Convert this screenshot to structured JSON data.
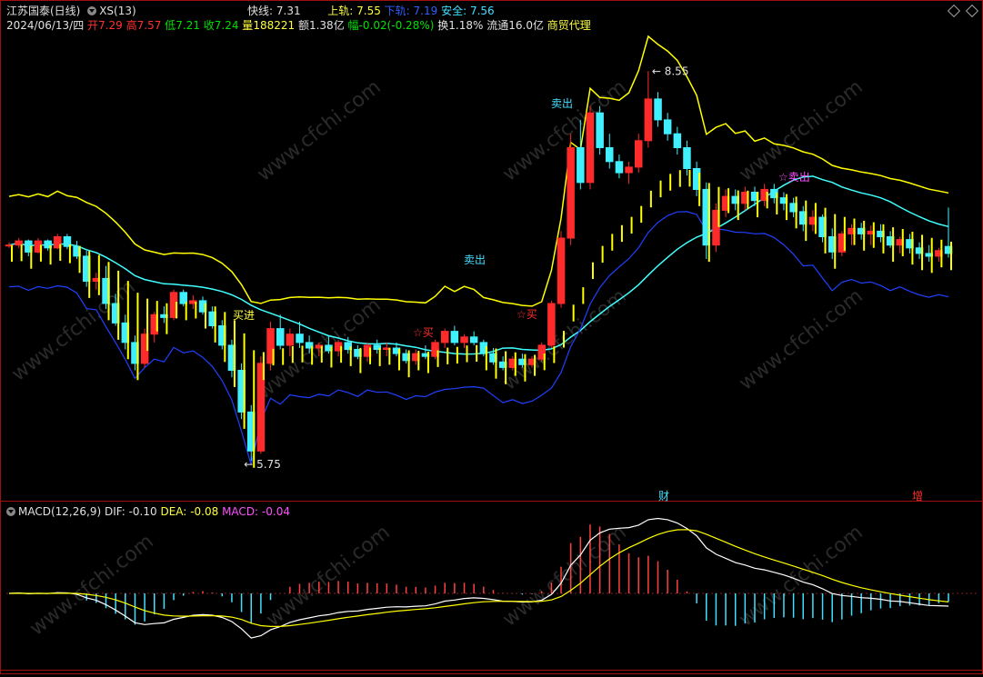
{
  "header": {
    "stock_name": "江苏国泰(日线)",
    "indicator_name": "XS(13)",
    "fast_label": "快线:",
    "fast_value": "7.31",
    "upper_label": "上轨:",
    "upper_value": "7.55",
    "lower_label": "下轨:",
    "lower_value": "7.19",
    "safe_label": "安全:",
    "safe_value": "7.56"
  },
  "quote": {
    "date": "2024/06/13/四",
    "open_label": "开",
    "open": "7.29",
    "high_label": "高",
    "high": "7.57",
    "low_label": "低",
    "low": "7.21",
    "close_label": "收",
    "close": "7.24",
    "volume_label": "量",
    "volume": "188221",
    "amount_label": "额",
    "amount": "1.38亿",
    "change_label": "幅",
    "change": "-0.02(-0.28%)",
    "turnover_label": "换",
    "turnover": "1.18%",
    "float_label": "流通",
    "float": "16.0亿",
    "sector": "商贸代理"
  },
  "macd_header": {
    "name": "MACD(12,26,9)",
    "dif_label": "DIF:",
    "dif": "-0.10",
    "dea_label": "DEA:",
    "dea": "-0.08",
    "macd_label": "MACD:",
    "macd": "-0.04"
  },
  "markers": {
    "low_price": "5.75",
    "high_price": "8.55",
    "sell_1": "卖出",
    "sell_2": "卖出",
    "sell_3": "☆卖出",
    "buy_in": "买进",
    "buy_1": "☆买",
    "buy_2": "☆买",
    "cai": "财",
    "zeng": "增"
  },
  "watermark": "www.cfchi.com",
  "colors": {
    "up": "#ff2a2a",
    "down": "#40f0ff",
    "bg": "#000000",
    "border": "#a01010",
    "fast_line": "#ffff00",
    "mid_line": "#40ffff",
    "lower_line": "#2040ff",
    "dif": "#ffffff",
    "dea": "#ffff00"
  },
  "chart_data": [
    {
      "type": "candlestick",
      "title": "江苏国泰(日线)",
      "y_unit": "CNY",
      "ylim": [
        5.6,
        8.8
      ],
      "annotations": [
        {
          "label": "5.75",
          "kind": "low"
        },
        {
          "label": "8.55",
          "kind": "high"
        }
      ],
      "last_candle": {
        "open": 7.29,
        "high": 7.57,
        "low": 7.21,
        "close": 7.24
      },
      "lines": [
        {
          "name": "快线",
          "last": 7.31
        },
        {
          "name": "上轨",
          "last": 7.55
        },
        {
          "name": "下轨",
          "last": 7.19
        },
        {
          "name": "安全",
          "last": 7.56
        }
      ],
      "candles_approx": [
        [
          7.3,
          7.32,
          7.28,
          7.3
        ],
        [
          7.3,
          7.35,
          7.28,
          7.33
        ],
        [
          7.33,
          7.34,
          7.22,
          7.25
        ],
        [
          7.25,
          7.35,
          7.24,
          7.33
        ],
        [
          7.33,
          7.34,
          7.26,
          7.28
        ],
        [
          7.28,
          7.38,
          7.27,
          7.36
        ],
        [
          7.36,
          7.38,
          7.27,
          7.29
        ],
        [
          7.29,
          7.33,
          7.2,
          7.22
        ],
        [
          7.22,
          7.26,
          7.0,
          7.04
        ],
        [
          7.04,
          7.1,
          6.98,
          7.06
        ],
        [
          7.06,
          7.15,
          6.84,
          6.88
        ],
        [
          6.88,
          6.95,
          6.72,
          6.74
        ],
        [
          6.74,
          6.8,
          6.55,
          6.6
        ],
        [
          6.6,
          6.65,
          6.4,
          6.45
        ],
        [
          6.45,
          6.7,
          6.42,
          6.66
        ],
        [
          6.66,
          6.82,
          6.6,
          6.8
        ],
        [
          6.8,
          6.86,
          6.74,
          6.78
        ],
        [
          6.78,
          6.98,
          6.76,
          6.96
        ],
        [
          6.96,
          6.98,
          6.86,
          6.88
        ],
        [
          6.88,
          6.94,
          6.84,
          6.9
        ],
        [
          6.9,
          6.93,
          6.8,
          6.82
        ],
        [
          6.82,
          6.86,
          6.7,
          6.72
        ],
        [
          6.72,
          6.76,
          6.55,
          6.58
        ],
        [
          6.58,
          6.62,
          6.35,
          6.4
        ],
        [
          6.4,
          6.45,
          6.05,
          6.1
        ],
        [
          6.1,
          6.15,
          5.75,
          5.82
        ],
        [
          5.82,
          6.5,
          5.8,
          6.45
        ],
        [
          6.45,
          6.75,
          6.4,
          6.7
        ],
        [
          6.7,
          6.8,
          6.55,
          6.58
        ],
        [
          6.58,
          6.7,
          6.5,
          6.66
        ],
        [
          6.66,
          6.75,
          6.56,
          6.6
        ],
        [
          6.6,
          6.65,
          6.52,
          6.56
        ],
        [
          6.56,
          6.6,
          6.5,
          6.58
        ],
        [
          6.58,
          6.65,
          6.52,
          6.54
        ],
        [
          6.54,
          6.62,
          6.5,
          6.6
        ],
        [
          6.6,
          6.64,
          6.52,
          6.55
        ],
        [
          6.55,
          6.58,
          6.48,
          6.5
        ],
        [
          6.5,
          6.6,
          6.46,
          6.58
        ],
        [
          6.58,
          6.62,
          6.52,
          6.55
        ],
        [
          6.55,
          6.6,
          6.5,
          6.56
        ],
        [
          6.56,
          6.6,
          6.5,
          6.52
        ],
        [
          6.52,
          6.55,
          6.45,
          6.47
        ],
        [
          6.47,
          6.55,
          6.44,
          6.52
        ],
        [
          6.52,
          6.58,
          6.48,
          6.5
        ],
        [
          6.5,
          6.62,
          6.48,
          6.6
        ],
        [
          6.6,
          6.7,
          6.56,
          6.68
        ],
        [
          6.68,
          6.72,
          6.58,
          6.6
        ],
        [
          6.6,
          6.66,
          6.56,
          6.64
        ],
        [
          6.64,
          6.68,
          6.58,
          6.6
        ],
        [
          6.6,
          6.62,
          6.5,
          6.52
        ],
        [
          6.52,
          6.56,
          6.44,
          6.46
        ],
        [
          6.46,
          6.5,
          6.4,
          6.42
        ],
        [
          6.42,
          6.5,
          6.4,
          6.48
        ],
        [
          6.48,
          6.52,
          6.42,
          6.44
        ],
        [
          6.44,
          6.5,
          6.42,
          6.48
        ],
        [
          6.48,
          6.6,
          6.46,
          6.58
        ],
        [
          6.58,
          6.9,
          6.56,
          6.88
        ],
        [
          6.88,
          7.4,
          6.85,
          7.35
        ],
        [
          7.35,
          8.1,
          7.3,
          8.0
        ],
        [
          8.0,
          8.2,
          7.7,
          7.75
        ],
        [
          7.75,
          8.3,
          7.7,
          8.25
        ],
        [
          8.25,
          8.3,
          7.95,
          8.0
        ],
        [
          8.0,
          8.1,
          7.85,
          7.9
        ],
        [
          7.9,
          7.95,
          7.78,
          7.82
        ],
        [
          7.82,
          7.9,
          7.74,
          7.86
        ],
        [
          7.86,
          8.1,
          7.82,
          8.05
        ],
        [
          8.05,
          8.55,
          8.0,
          8.35
        ],
        [
          8.35,
          8.4,
          8.15,
          8.2
        ],
        [
          8.2,
          8.25,
          8.05,
          8.1
        ],
        [
          8.1,
          8.15,
          7.95,
          8.0
        ],
        [
          8.0,
          8.05,
          7.8,
          7.85
        ],
        [
          7.85,
          7.9,
          7.65,
          7.7
        ],
        [
          7.7,
          7.75,
          7.2,
          7.3
        ],
        [
          7.3,
          7.6,
          7.25,
          7.55
        ],
        [
          7.55,
          7.7,
          7.5,
          7.65
        ],
        [
          7.65,
          7.7,
          7.55,
          7.6
        ],
        [
          7.6,
          7.72,
          7.55,
          7.68
        ],
        [
          7.68,
          7.72,
          7.58,
          7.62
        ],
        [
          7.62,
          7.74,
          7.58,
          7.7
        ],
        [
          7.7,
          7.74,
          7.6,
          7.64
        ],
        [
          7.64,
          7.68,
          7.55,
          7.6
        ],
        [
          7.6,
          7.64,
          7.5,
          7.54
        ],
        [
          7.54,
          7.58,
          7.4,
          7.45
        ],
        [
          7.45,
          7.55,
          7.4,
          7.5
        ],
        [
          7.5,
          7.52,
          7.32,
          7.36
        ],
        [
          7.36,
          7.42,
          7.2,
          7.25
        ],
        [
          7.25,
          7.4,
          7.22,
          7.38
        ],
        [
          7.38,
          7.45,
          7.3,
          7.42
        ],
        [
          7.42,
          7.46,
          7.34,
          7.38
        ],
        [
          7.38,
          7.44,
          7.3,
          7.4
        ],
        [
          7.4,
          7.45,
          7.32,
          7.36
        ],
        [
          7.36,
          7.4,
          7.28,
          7.3
        ],
        [
          7.3,
          7.36,
          7.24,
          7.34
        ],
        [
          7.34,
          7.38,
          7.24,
          7.28
        ],
        [
          7.28,
          7.32,
          7.2,
          7.24
        ],
        [
          7.24,
          7.3,
          7.18,
          7.22
        ],
        [
          7.22,
          7.28,
          7.18,
          7.26
        ],
        [
          7.29,
          7.57,
          7.21,
          7.24
        ]
      ]
    },
    {
      "type": "macd",
      "title": "MACD(12,26,9)",
      "params": [
        12,
        26,
        9
      ],
      "last": {
        "DIF": -0.1,
        "DEA": -0.08,
        "MACD": -0.04
      }
    }
  ]
}
